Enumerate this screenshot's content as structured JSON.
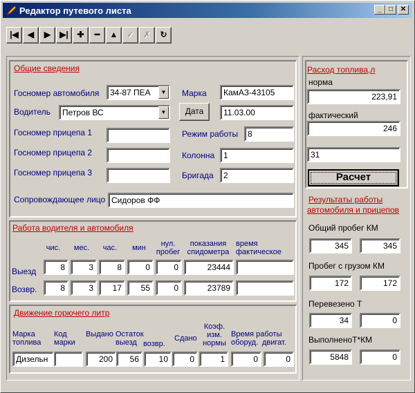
{
  "window": {
    "title": "Редактор путевого листа",
    "controls": {
      "minimize": "_",
      "maximize": "□",
      "close": "✕"
    }
  },
  "toolbar": {
    "buttons": [
      {
        "icon": "first-record-icon",
        "glyph": "|◀",
        "enabled": true
      },
      {
        "icon": "prior-record-icon",
        "glyph": "◀",
        "enabled": true
      },
      {
        "icon": "next-record-icon",
        "glyph": "▶",
        "enabled": true
      },
      {
        "icon": "last-record-icon",
        "glyph": "▶|",
        "enabled": true
      },
      {
        "icon": "insert-icon",
        "glyph": "✚",
        "enabled": true
      },
      {
        "icon": "delete-icon",
        "glyph": "━",
        "enabled": true
      },
      {
        "icon": "edit-icon",
        "glyph": "▲",
        "enabled": true
      },
      {
        "icon": "post-check-icon",
        "glyph": "✓",
        "enabled": false
      },
      {
        "icon": "cancel-x-icon",
        "glyph": "✗",
        "enabled": false
      },
      {
        "icon": "refresh-icon",
        "glyph": "↻",
        "enabled": true
      }
    ]
  },
  "general": {
    "group_label": "Общие сведения",
    "vehicle_plate_label": "Госномер автомобиля",
    "vehicle_plate_value": "34-87 ПЕА",
    "brand_label": "Марка",
    "brand_value": "КамАЗ-43105",
    "driver_label": "Водитель",
    "driver_value": "Петров ВС",
    "date_button": "Дата",
    "date_value": "11.03.00",
    "trailer1_label": "Госномер прицепа 1",
    "trailer1_value": "",
    "work_mode_label": "Режим работы",
    "work_mode_value": "8",
    "trailer2_label": "Госномер прицепа 2",
    "trailer2_value": "",
    "column_label": "Колонна",
    "column_value": "1",
    "trailer3_label": "Госномер прицепа 3",
    "trailer3_value": "",
    "brigade_label": "Бригада",
    "brigade_value": "2",
    "escort_label": "Сопровождающее лицо",
    "escort_value": "Сидоров ФФ"
  },
  "work": {
    "group_label": "Работа водителя и автомобиля",
    "headers": {
      "day": "чис.",
      "month": "мес.",
      "hour": "час.",
      "minute": "мин",
      "zero_run_1": "нул.",
      "zero_run_2": "пробег",
      "odometer_1": "показания",
      "odometer_2": "спидометра",
      "actual_time_1": "время",
      "actual_time_2": "фактическое"
    },
    "departure": {
      "label": "Выезд",
      "day": "8",
      "month": "3",
      "hour": "8",
      "minute": "0",
      "zero_run": "0",
      "odometer": "23444",
      "actual_time": ""
    },
    "return": {
      "label": "Возвр.",
      "day": "8",
      "month": "3",
      "hour": "17",
      "minute": "55",
      "zero_run": "0",
      "odometer": "23789",
      "actual_time": ""
    }
  },
  "fuel_move": {
    "group_label": "Движение горючего литр",
    "headers": {
      "fuel_brand_1": "Марка",
      "fuel_brand_2": "топлива",
      "code_1": "Код",
      "code_2": "марки",
      "issued": "Выдано",
      "remain_1": "Остаток",
      "remain_out": "выезд",
      "remain_ret": "возвр.",
      "handed": "Сдано",
      "coef_1": "Коэф.",
      "coef_2": "изм.",
      "coef_3": "нормы",
      "work_time_1": "Время работы",
      "work_time_equip": "оборуд.",
      "work_time_engine": "двигат."
    },
    "row": {
      "fuel_brand": "Дизельн",
      "code": "",
      "issued": "200",
      "remain_out": "56",
      "remain_ret": "10",
      "handed": "0",
      "coef": "1",
      "equip_time": "0",
      "engine_time": "0"
    }
  },
  "fuel_consumption": {
    "group_label": "Расход топлива,л",
    "norm_label": "норма",
    "norm_value": "223,91",
    "actual_label": "фактический",
    "actual_value": "246",
    "extra_value": "31",
    "calc_button": "Расчет"
  },
  "results": {
    "group_label_1": "Результаты работы",
    "group_label_2": "автомобиля и прицепов",
    "total_run_label": "Общий пробег КМ",
    "total_run_1": "345",
    "total_run_2": "345",
    "cargo_run_label": "Пробег с грузом КМ",
    "cargo_run_1": "172",
    "cargo_run_2": "172",
    "transported_label": "Перевезено Т",
    "transported_1": "34",
    "transported_2": "0",
    "done_tkm_label": "ВыполненоТ*КМ",
    "done_tkm_1": "5848",
    "done_tkm_2": "0"
  }
}
